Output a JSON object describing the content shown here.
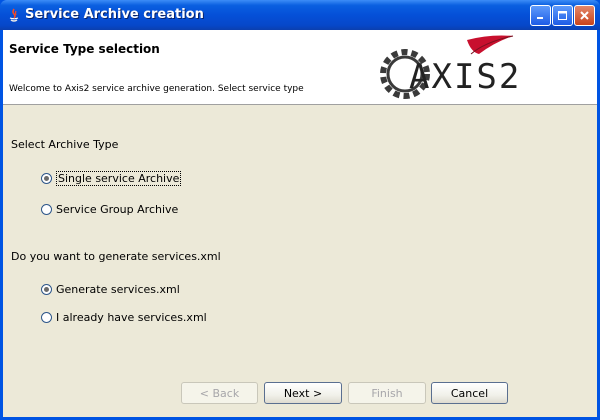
{
  "window": {
    "title": "Service Archive creation"
  },
  "header": {
    "title": "Service Type selection",
    "description": "Welcome to Axis2 service archive generation. Select service type",
    "logo_text": "AXIS2"
  },
  "archive_type": {
    "label": "Select Archive Type",
    "options": [
      {
        "label": "Single service Archive",
        "selected": true
      },
      {
        "label": "Service Group Archive",
        "selected": false
      }
    ]
  },
  "services_xml": {
    "label": "Do you want to generate services.xml",
    "options": [
      {
        "label": "Generate services.xml",
        "selected": true
      },
      {
        "label": "I already have services.xml",
        "selected": false
      }
    ]
  },
  "buttons": {
    "back": "< Back",
    "next": "Next >",
    "finish": "Finish",
    "cancel": "Cancel"
  },
  "colors": {
    "titlebar": "#0a5fe0",
    "panel": "#ece9d8",
    "header_bg": "#ffffff",
    "feather_red": "#c8102e"
  }
}
